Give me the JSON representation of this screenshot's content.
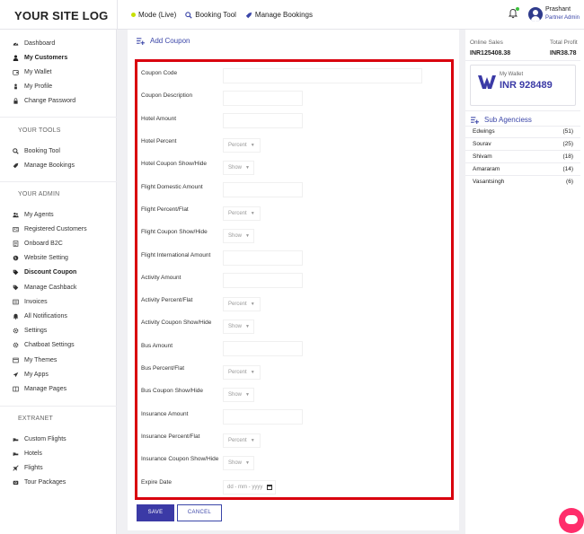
{
  "brand": {
    "logo_text": "YOUR SITE LOG"
  },
  "topnav": {
    "mode_label": "Mode (Live)",
    "booking_tool": "Booking Tool",
    "manage_bookings": "Manage Bookings"
  },
  "user": {
    "name": "Prashant",
    "role": "Partner Admin"
  },
  "sidebar": {
    "main_items": [
      {
        "label": "Dashboard",
        "icon": "dashboard-icon"
      },
      {
        "label": "My Customers",
        "icon": "user-icon"
      },
      {
        "label": "My Wallet",
        "icon": "wallet-icon"
      },
      {
        "label": "My Profile",
        "icon": "profile-icon"
      },
      {
        "label": "Change Password",
        "icon": "lock-icon"
      }
    ],
    "tools_heading": "YOUR TOOLS",
    "tools_items": [
      {
        "label": "Booking Tool",
        "icon": "search-icon"
      },
      {
        "label": "Manage Bookings",
        "icon": "rocket-icon"
      }
    ],
    "admin_heading": "YOUR ADMIN",
    "admin_items": [
      {
        "label": "My Agents",
        "icon": "users-icon"
      },
      {
        "label": "Registered Customers",
        "icon": "id-card-icon"
      },
      {
        "label": "Onboard B2C",
        "icon": "list-icon"
      },
      {
        "label": "Website Setting",
        "icon": "globe-icon"
      },
      {
        "label": "Discount Coupon",
        "icon": "tags-icon"
      },
      {
        "label": "Manage Cashback",
        "icon": "tag-icon"
      },
      {
        "label": "Invoices",
        "icon": "invoice-icon"
      },
      {
        "label": "All Notifications",
        "icon": "bell-icon"
      },
      {
        "label": "Settings",
        "icon": "gear-icon"
      },
      {
        "label": "Chatboat Settings",
        "icon": "chat-gear-icon"
      },
      {
        "label": "My Themes",
        "icon": "themes-icon"
      },
      {
        "label": "My Apps",
        "icon": "send-icon"
      },
      {
        "label": "Manage Pages",
        "icon": "pages-icon"
      }
    ],
    "extranet_heading": "EXTRANET",
    "extranet_items": [
      {
        "label": "Custom Flights",
        "icon": "bed-icon"
      },
      {
        "label": "Hotels",
        "icon": "hotel-icon"
      },
      {
        "label": "Flights",
        "icon": "plane-icon"
      },
      {
        "label": "Tour Packages",
        "icon": "camera-icon"
      }
    ]
  },
  "form": {
    "title": "Add Coupon",
    "fields": {
      "coupon_code": "Coupon Code",
      "coupon_description": "Coupon Description",
      "hotel_amount": "Hotel Amount",
      "hotel_percent": "Hotel Percent",
      "hotel_show": "Hotel Coupon Show/Hide",
      "flight_domestic_amount": "Flight Domestic Amount",
      "flight_percent": "Flight Percent/Flat",
      "flight_show": "Flight Coupon Show/Hide",
      "flight_international_amount": "Flight International Amount",
      "activity_amount": "Activity Amount",
      "activity_percent": "Activity Percent/Flat",
      "activity_show": "Activity Coupon Show/Hide",
      "bus_amount": "Bus Amount",
      "bus_percent": "Bus Percent/Flat",
      "bus_show": "Bus Coupon Show/Hide",
      "insurance_amount": "Insurance Amount",
      "insurance_percent": "Insurance Percent/Flat",
      "insurance_show": "Insurance Coupon Show/Hide",
      "expire_date": "Expire Date"
    },
    "percent_option": "Percent",
    "show_option": "Show",
    "date_placeholder": "dd - mm - yyyy",
    "save_label": "SAVE",
    "cancel_label": "CANCEL"
  },
  "stats": {
    "online_sales_label": "Online Sales",
    "online_sales_value": "INR125408.38",
    "total_profit_label": "Total Profit",
    "total_profit_value": "INR38.78"
  },
  "wallet": {
    "label": "My Wallet",
    "value": "INR 928489"
  },
  "agencies": {
    "heading": "Sub Agenciess",
    "rows": [
      {
        "name": "Edwings",
        "count": "(51)"
      },
      {
        "name": "Sourav",
        "count": "(25)"
      },
      {
        "name": "Shivam",
        "count": "(18)"
      },
      {
        "name": "Amararam",
        "count": "(14)"
      },
      {
        "name": "Vasantsingh",
        "count": "(6)"
      }
    ]
  },
  "colors": {
    "accent": "#3b3aa6",
    "highlight": "#d9000d",
    "chat": "#ff2d6b"
  }
}
